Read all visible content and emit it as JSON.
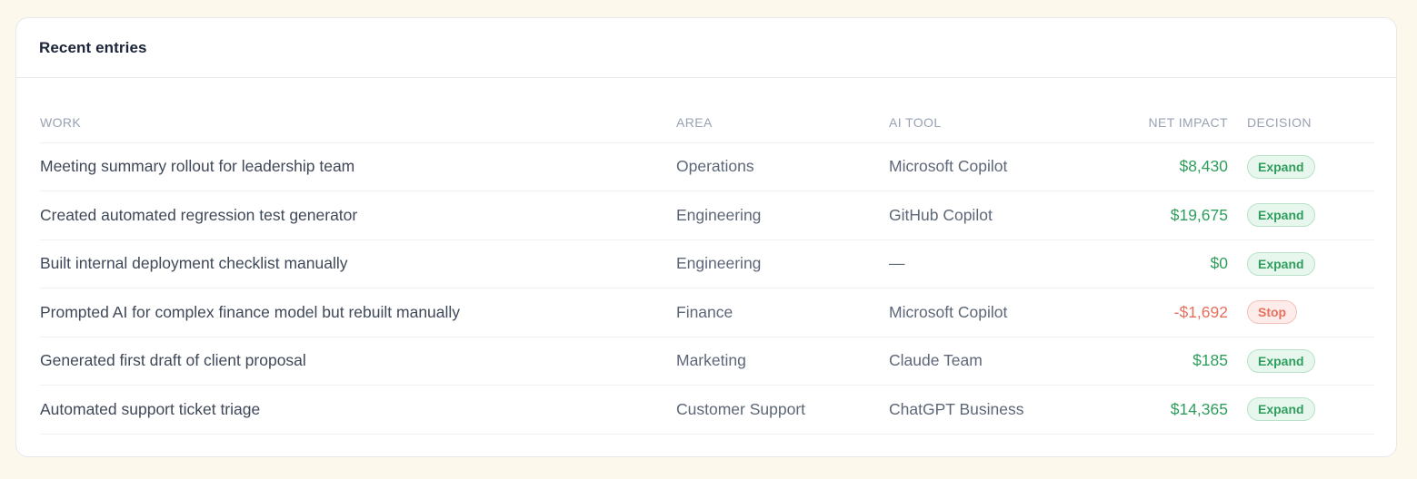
{
  "card": {
    "title": "Recent entries"
  },
  "table": {
    "headers": {
      "work": "WORK",
      "area": "AREA",
      "tool": "AI TOOL",
      "net_impact": "NET IMPACT",
      "decision": "DECISION"
    },
    "rows": [
      {
        "work": "Meeting summary rollout for leadership team",
        "area": "Operations",
        "tool": "Microsoft Copilot",
        "net_impact": "$8,430",
        "decision": "Expand"
      },
      {
        "work": "Created automated regression test generator",
        "area": "Engineering",
        "tool": "GitHub Copilot",
        "net_impact": "$19,675",
        "decision": "Expand"
      },
      {
        "work": "Built internal deployment checklist manually",
        "area": "Engineering",
        "tool": "—",
        "net_impact": "$0",
        "decision": "Expand"
      },
      {
        "work": "Prompted AI for complex finance model but rebuilt manually",
        "area": "Finance",
        "tool": "Microsoft Copilot",
        "net_impact": "-$1,692",
        "decision": "Stop"
      },
      {
        "work": "Generated first draft of client proposal",
        "area": "Marketing",
        "tool": "Claude Team",
        "net_impact": "$185",
        "decision": "Expand"
      },
      {
        "work": "Automated support ticket triage",
        "area": "Customer Support",
        "tool": "ChatGPT Business",
        "net_impact": "$14,365",
        "decision": "Expand"
      }
    ]
  },
  "colors": {
    "page_background": "#fdf8ec",
    "positive": "#2f9e5d",
    "negative": "#e8705e",
    "header_text": "#98a2b3"
  }
}
